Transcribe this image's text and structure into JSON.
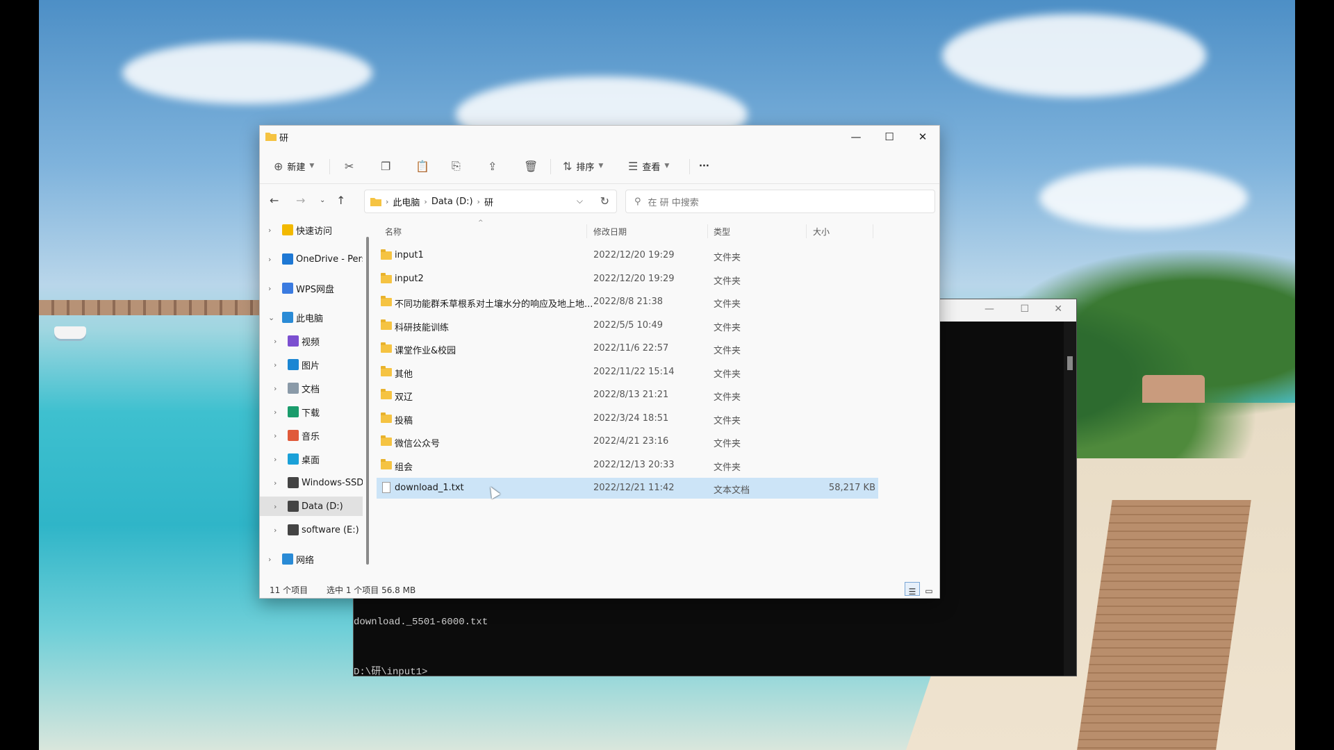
{
  "console": {
    "line1": "download._5501-6000.txt",
    "line2": "D:\\研\\input1>"
  },
  "explorer": {
    "title": "研",
    "toolbar": {
      "new_label": "新建",
      "sort_label": "排序",
      "view_label": "查看",
      "more_label": "···"
    },
    "address": {
      "segments": [
        "此电脑",
        "Data (D:)",
        "研"
      ]
    },
    "search": {
      "placeholder": "在 研 中搜索"
    },
    "sidebar": {
      "items": [
        {
          "label": "快速访问",
          "icon": "star-icon",
          "color": "#f2b900"
        },
        {
          "label": "OneDrive - Pers",
          "icon": "cloud-icon",
          "color": "#1e78d4"
        },
        {
          "label": "WPS网盘",
          "icon": "cloud-icon",
          "color": "#3b7be0"
        },
        {
          "label": "此电脑",
          "icon": "computer-icon",
          "color": "#2a8bd6"
        },
        {
          "label": "视频",
          "icon": "video-icon",
          "color": "#7b4fd0"
        },
        {
          "label": "图片",
          "icon": "picture-icon",
          "color": "#1b86d3"
        },
        {
          "label": "文档",
          "icon": "document-icon",
          "color": "#8a9aa8"
        },
        {
          "label": "下载",
          "icon": "download-icon",
          "color": "#1a9c6c"
        },
        {
          "label": "音乐",
          "icon": "music-icon",
          "color": "#e05a3a"
        },
        {
          "label": "桌面",
          "icon": "desktop-icon",
          "color": "#1aa0d8"
        },
        {
          "label": "Windows-SSD",
          "icon": "drive-icon",
          "color": "#444444"
        },
        {
          "label": "Data (D:)",
          "icon": "drive-icon",
          "color": "#444444"
        },
        {
          "label": "software (E:)",
          "icon": "drive-icon",
          "color": "#444444"
        },
        {
          "label": "网络",
          "icon": "network-icon",
          "color": "#2a8bd6"
        }
      ]
    },
    "columns": {
      "name": "名称",
      "date": "修改日期",
      "type": "类型",
      "size": "大小"
    },
    "files": [
      {
        "name": "input1",
        "date": "2022/12/20 19:29",
        "type": "文件夹",
        "size": ""
      },
      {
        "name": "input2",
        "date": "2022/12/20 19:29",
        "type": "文件夹",
        "size": ""
      },
      {
        "name": "不同功能群禾草根系对土壤水分的响应及地上地...",
        "date": "2022/8/8 21:38",
        "type": "文件夹",
        "size": ""
      },
      {
        "name": "科研技能训练",
        "date": "2022/5/5 10:49",
        "type": "文件夹",
        "size": ""
      },
      {
        "name": "课堂作业&校园",
        "date": "2022/11/6 22:57",
        "type": "文件夹",
        "size": ""
      },
      {
        "name": "其他",
        "date": "2022/11/22 15:14",
        "type": "文件夹",
        "size": ""
      },
      {
        "name": "双辽",
        "date": "2022/8/13 21:21",
        "type": "文件夹",
        "size": ""
      },
      {
        "name": "投稿",
        "date": "2022/3/24 18:51",
        "type": "文件夹",
        "size": ""
      },
      {
        "name": "微信公众号",
        "date": "2022/4/21 23:16",
        "type": "文件夹",
        "size": ""
      },
      {
        "name": "组会",
        "date": "2022/12/13 20:33",
        "type": "文件夹",
        "size": ""
      },
      {
        "name": "download_1.txt",
        "date": "2022/12/21 11:42",
        "type": "文本文档",
        "size": "58,217 KB"
      }
    ],
    "status": {
      "count": "11 个项目",
      "selection": "选中 1 个项目  56.8 MB"
    }
  }
}
